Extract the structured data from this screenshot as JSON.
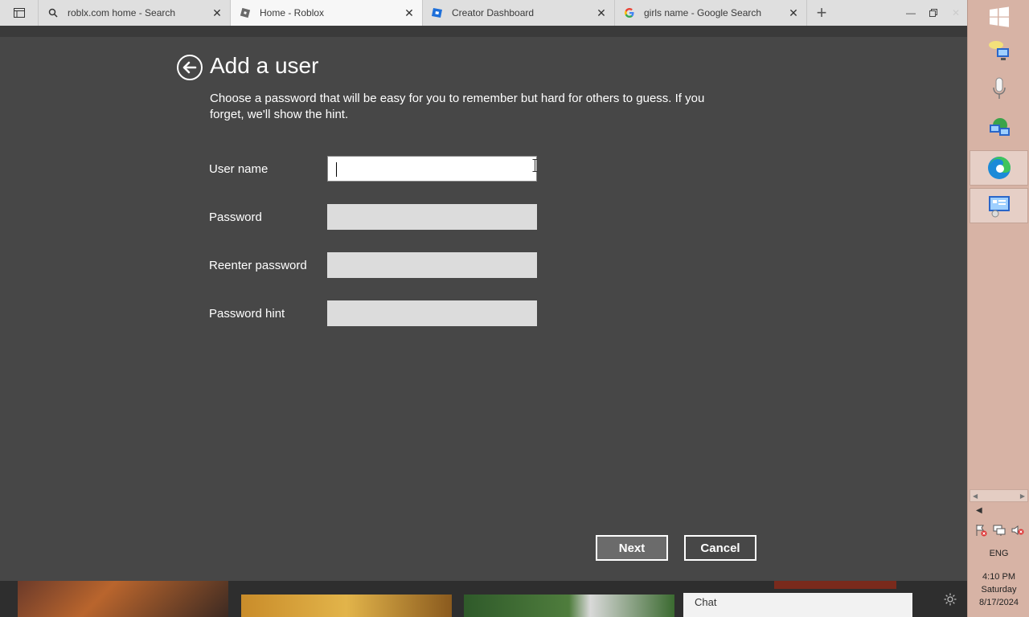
{
  "browser": {
    "tabs": [
      {
        "title": "roblx.com home - Search",
        "icon": "search-icon"
      },
      {
        "title": "Home - Roblox",
        "icon": "roblox-icon"
      },
      {
        "title": "Creator Dashboard",
        "icon": "roblox-studio-icon"
      },
      {
        "title": "girls name - Google Search",
        "icon": "google-icon"
      }
    ],
    "active_tab": 1,
    "close_glyph": "✕",
    "new_tab_glyph": "+"
  },
  "dialog": {
    "title": "Add a user",
    "description": "Choose a password that will be easy for you to remember but hard for others to guess. If you forget, we'll show the hint.",
    "fields": [
      {
        "label": "User name",
        "value": "",
        "focused": true
      },
      {
        "label": "Password",
        "value": ""
      },
      {
        "label": "Reenter password",
        "value": ""
      },
      {
        "label": "Password hint",
        "value": ""
      }
    ],
    "next_label": "Next",
    "cancel_label": "Cancel"
  },
  "bottom": {
    "chat_label": "Chat"
  },
  "taskbar": {
    "language": "ENG",
    "time": "4:10 PM",
    "day": "Saturday",
    "date": "8/17/2024"
  },
  "colors": {
    "dialog_bg": "#474747",
    "taskbar_bg": "#d7b3a5",
    "field_bg": "#dcdcdc"
  }
}
